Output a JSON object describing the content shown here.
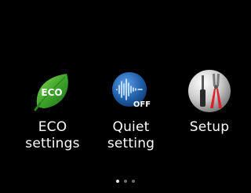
{
  "menu": {
    "items": [
      {
        "icon": "eco-leaf-icon",
        "icon_text": "ECO",
        "label_line1": "ECO",
        "label_line2": "settings"
      },
      {
        "icon": "quiet-soundwave-icon",
        "icon_text": "OFF",
        "label_line1": "Quiet",
        "label_line2": "setting"
      },
      {
        "icon": "setup-tools-icon",
        "label_line1": "Setup",
        "label_line2": ""
      }
    ]
  },
  "pager": {
    "pages": 3,
    "active_index": 0
  },
  "colors": {
    "background": "#000000",
    "eco_green": "#3a9a2a",
    "quiet_blue": "#1f5fa8",
    "text": "#ffffff"
  }
}
